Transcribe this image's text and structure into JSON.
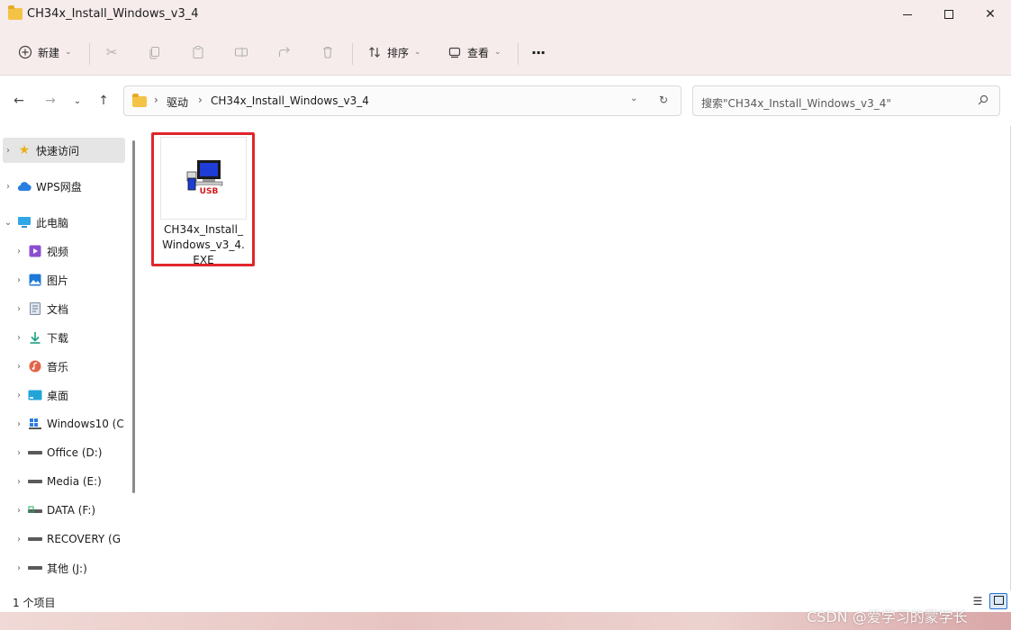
{
  "window": {
    "title": "CH34x_Install_Windows_v3_4"
  },
  "toolbar": {
    "new_label": "新建",
    "sort_label": "排序",
    "view_label": "查看",
    "more_label": "···"
  },
  "nav": {
    "path": [
      "驱动",
      "CH34x_Install_Windows_v3_4"
    ],
    "search_placeholder": "搜索\"CH34x_Install_Windows_v3_4\""
  },
  "sidebar": {
    "items": [
      {
        "label": "快速访问",
        "icon": "star-icon"
      },
      {
        "label": "WPS网盘",
        "icon": "cloud-icon"
      },
      {
        "label": "此电脑",
        "icon": "computer-icon"
      },
      {
        "label": "视频",
        "icon": "video-icon"
      },
      {
        "label": "图片",
        "icon": "picture-icon"
      },
      {
        "label": "文档",
        "icon": "document-icon"
      },
      {
        "label": "下载",
        "icon": "download-icon"
      },
      {
        "label": "音乐",
        "icon": "music-icon"
      },
      {
        "label": "桌面",
        "icon": "desktop-icon"
      },
      {
        "label": "Windows10 (C",
        "icon": "windows-drive-icon"
      },
      {
        "label": "Office (D:)",
        "icon": "drive-icon"
      },
      {
        "label": "Media (E:)",
        "icon": "drive-icon"
      },
      {
        "label": "DATA (F:)",
        "icon": "drive-icon"
      },
      {
        "label": "RECOVERY (G",
        "icon": "drive-icon"
      },
      {
        "label": "其他 (J:)",
        "icon": "drive-icon"
      }
    ]
  },
  "content": {
    "files": [
      {
        "name_lines": [
          "CH34x_Install_",
          "Windows_v3_4.",
          "EXE"
        ],
        "icon": "usb-installer-icon",
        "icon_text": "USB"
      }
    ]
  },
  "status": {
    "item_count": "1 个项目"
  },
  "watermark": "CSDN @爱学习的蒙学长",
  "colors": {
    "highlight": "#e0262a",
    "titlebar": "#f7ecec",
    "folder": "#f4c345"
  }
}
